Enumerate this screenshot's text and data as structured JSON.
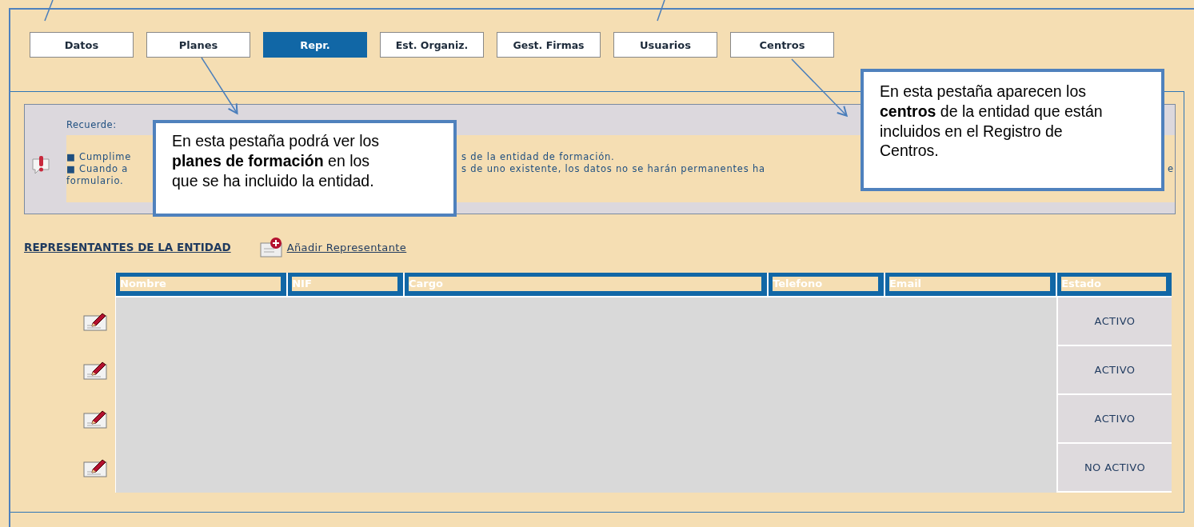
{
  "tabs": [
    {
      "label": "Datos",
      "selected": false
    },
    {
      "label": "Planes",
      "selected": false
    },
    {
      "label": "Repr.",
      "selected": true
    },
    {
      "label": "Est. Organiz.",
      "selected": false
    },
    {
      "label": "Gest. Firmas",
      "selected": false
    },
    {
      "label": "Usuarios",
      "selected": false
    },
    {
      "label": "Centros",
      "selected": false
    }
  ],
  "notice": {
    "title": "Recuerde:",
    "lines": [
      [
        "■ Cumplime",
        "s de la entidad de formación."
      ],
      [
        "■ Cuando a",
        "s de uno existente, los datos no se harán permanentes ha",
        "e"
      ],
      [
        "formulario."
      ]
    ]
  },
  "section": {
    "title": "REPRESENTANTES DE LA ENTIDAD",
    "add_link": "Añadir Representante"
  },
  "table": {
    "columns": [
      "Nombre",
      "NIF",
      "Cargo",
      "Telefono",
      "Email",
      "Estado"
    ],
    "rows": [
      {
        "estado": "ACTIVO"
      },
      {
        "estado": "ACTIVO"
      },
      {
        "estado": "ACTIVO"
      },
      {
        "estado": "NO ACTIVO"
      }
    ]
  },
  "callouts": [
    {
      "text": "En esta pestaña podrá ver los **planes de formación** en los que se ha incluido la entidad."
    },
    {
      "text": "En esta pestaña aparecen los **centros** de la entidad que están incluidos en el Registro de Centros."
    }
  ]
}
